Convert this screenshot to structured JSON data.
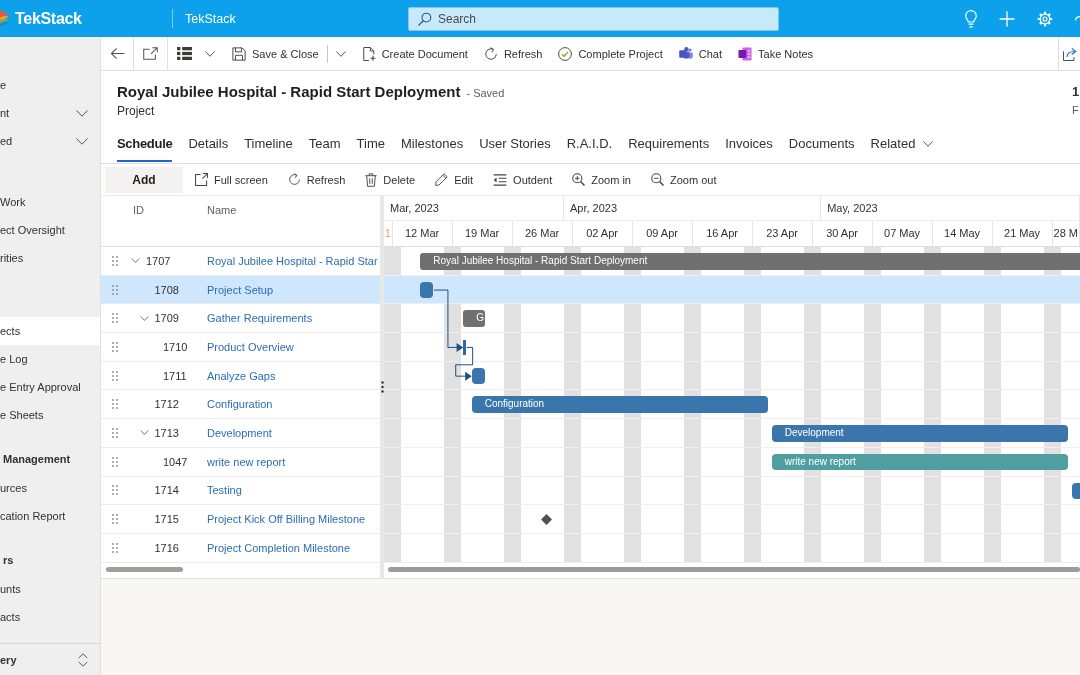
{
  "top_bar": {
    "logo_text": "TekStack",
    "app_name": "TekStack",
    "search": {
      "placeholder": "Search"
    }
  },
  "sidebar": {
    "top_items": [
      {
        "label": "e",
        "kind": "link",
        "selected": false
      },
      {
        "label": "nt",
        "kind": "group",
        "expanded": false,
        "selected": false
      },
      {
        "label": "ed",
        "kind": "group",
        "expanded": false,
        "selected": false
      }
    ],
    "groups": [
      {
        "items": [
          {
            "label": "Work",
            "selected": false
          },
          {
            "label": "ect Oversight",
            "selected": false
          },
          {
            "label": "rities",
            "selected": false
          }
        ]
      },
      {
        "items": [
          {
            "label": "ects",
            "selected": true
          },
          {
            "label": "e Log",
            "selected": false
          },
          {
            "label": "e Entry Approval",
            "selected": false
          },
          {
            "label": "e Sheets",
            "selected": false
          }
        ]
      },
      {
        "title": "Management",
        "items": [
          {
            "label": "urces",
            "selected": false
          },
          {
            "label": "cation Report",
            "selected": false
          }
        ]
      },
      {
        "title": "rs",
        "items": [
          {
            "label": "unts",
            "selected": false
          },
          {
            "label": "acts",
            "selected": false
          }
        ]
      }
    ],
    "area_switcher": {
      "label": "ery"
    }
  },
  "command_bar": {
    "commands": [
      {
        "label": "Save & Close",
        "kind": "split"
      },
      {
        "label": "Create Document",
        "kind": "button"
      },
      {
        "label": "Refresh",
        "kind": "button"
      },
      {
        "label": "Complete Project",
        "kind": "button"
      },
      {
        "label": "Chat",
        "kind": "button"
      },
      {
        "label": "Take Notes",
        "kind": "button"
      }
    ]
  },
  "record": {
    "title": "Royal Jubilee Hospital - Rapid Start Deployment",
    "save_status": "- Saved",
    "entity": "Project",
    "header_field": {
      "value": "1",
      "label": "F"
    }
  },
  "tabs": [
    {
      "label": "Schedule",
      "selected": true,
      "kind": "tab"
    },
    {
      "label": "Details",
      "selected": false,
      "kind": "tab"
    },
    {
      "label": "Timeline",
      "selected": false,
      "kind": "tab"
    },
    {
      "label": "Team",
      "selected": false,
      "kind": "tab"
    },
    {
      "label": "Time",
      "selected": false,
      "kind": "tab"
    },
    {
      "label": "Milestones",
      "selected": false,
      "kind": "tab"
    },
    {
      "label": "User Stories",
      "selected": false,
      "kind": "tab"
    },
    {
      "label": "R.A.I.D.",
      "selected": false,
      "kind": "tab"
    },
    {
      "label": "Requirements",
      "selected": false,
      "kind": "tab"
    },
    {
      "label": "Invoices",
      "selected": false,
      "kind": "tab"
    },
    {
      "label": "Documents",
      "selected": false,
      "kind": "tab"
    },
    {
      "label": "Related",
      "selected": false,
      "kind": "menu"
    }
  ],
  "gantt": {
    "toolbar": [
      {
        "label": "Add",
        "kind": "primary"
      },
      {
        "label": "Full screen",
        "kind": "tool"
      },
      {
        "label": "Refresh",
        "kind": "tool"
      },
      {
        "label": "Delete",
        "kind": "tool"
      },
      {
        "label": "Edit",
        "kind": "tool"
      },
      {
        "label": "Outdent",
        "kind": "tool"
      },
      {
        "label": "Zoom in",
        "kind": "tool"
      },
      {
        "label": "Zoom out",
        "kind": "tool"
      }
    ],
    "columns": [
      "ID",
      "Name"
    ],
    "timeline": {
      "months": [
        {
          "label": "Mar, 2023"
        },
        {
          "label": "Apr, 2023"
        },
        {
          "label": "May, 2023"
        }
      ],
      "weeks": [
        {
          "label": "1",
          "kind": "cut"
        },
        {
          "label": "12 Mar",
          "kind": "week"
        },
        {
          "label": "19 Mar",
          "kind": "week"
        },
        {
          "label": "26 Mar",
          "kind": "week"
        },
        {
          "label": "02 Apr",
          "kind": "week"
        },
        {
          "label": "09 Apr",
          "kind": "week"
        },
        {
          "label": "16 Apr",
          "kind": "week"
        },
        {
          "label": "23 Apr",
          "kind": "week"
        },
        {
          "label": "30 Apr",
          "kind": "week"
        },
        {
          "label": "07 May",
          "kind": "week"
        },
        {
          "label": "14 May",
          "kind": "week"
        },
        {
          "label": "21 May",
          "kind": "week"
        },
        {
          "label": "28 M",
          "kind": "week"
        }
      ]
    },
    "tasks": [
      {
        "id": "1707",
        "name": "Royal Jubilee Hospital - Rapid Star",
        "expanded": true,
        "selected": false,
        "bar": {
          "kind": "summary",
          "color": "#707070",
          "label": "Royal Jubilee Hospital - Rapid Start Deployment",
          "linked": false
        },
        "children": [
          {
            "id": "1708",
            "name": "Project Setup",
            "selected": true,
            "bar": {
              "kind": "task",
              "color": "#3a76ab",
              "linked": false
            }
          },
          {
            "id": "1709",
            "name": "Gather Requirements",
            "expanded": true,
            "selected": false,
            "bar": {
              "kind": "summary",
              "color": "#707070",
              "label": "G",
              "linked": false
            },
            "children": [
              {
                "id": "1710",
                "name": "Product Overview",
                "selected": false,
                "bar": {
                  "kind": "point",
                  "color": "#2f69a0",
                  "linked": true
                }
              },
              {
                "id": "1711",
                "name": "Analyze Gaps",
                "selected": false,
                "bar": {
                  "kind": "task",
                  "color": "#3a76ab",
                  "linked": true
                }
              }
            ]
          },
          {
            "id": "1712",
            "name": "Configuration",
            "selected": false,
            "bar": {
              "kind": "task",
              "color": "#3a76ab",
              "label": "Configuration",
              "linked": false
            }
          },
          {
            "id": "1713",
            "name": "Development",
            "expanded": true,
            "selected": false,
            "bar": {
              "kind": "task",
              "color": "#3a76ab",
              "label": "Development",
              "linked": false
            },
            "children": [
              {
                "id": "1047",
                "name": "write new report",
                "selected": false,
                "bar": {
                  "kind": "task",
                  "color": "#4f9fa0",
                  "label": "write new report",
                  "linked": false
                }
              }
            ]
          },
          {
            "id": "1714",
            "name": "Testing",
            "selected": false,
            "bar": {
              "kind": "task",
              "color": "#3a76ab",
              "linked": false
            }
          },
          {
            "id": "1715",
            "name": "Project Kick Off Billing Milestone",
            "selected": false,
            "bar": {
              "kind": "milestone",
              "color": "#505050",
              "linked": false
            }
          },
          {
            "id": "1716",
            "name": "Project Completion Milestone",
            "selected": false
          }
        ]
      }
    ]
  }
}
